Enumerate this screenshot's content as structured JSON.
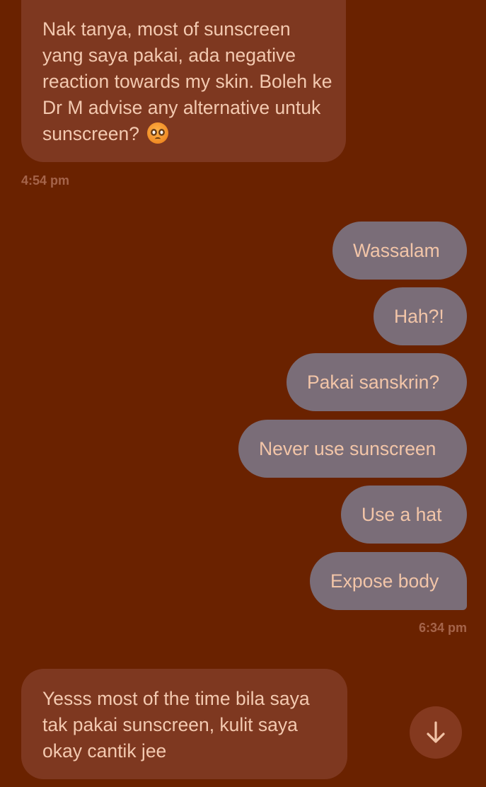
{
  "messages": {
    "incoming_1": {
      "text": "Nak tanya, most of sunscreen yang saya pakai, ada negative reaction towards my skin. Boleh ke Dr M advise any alternative untuk sunscreen?",
      "emoji": "pleading-face-emoji",
      "time": "4:54 pm"
    },
    "outgoing": [
      {
        "text": "Wassalam"
      },
      {
        "text": "Hah?!"
      },
      {
        "text": "Pakai sanskrin?"
      },
      {
        "text": "Never use sunscreen"
      },
      {
        "text": "Use a hat"
      },
      {
        "text": "Expose body"
      }
    ],
    "outgoing_time": "6:34 pm",
    "incoming_2": {
      "text": "Yesss most of the time bila saya tak pakai sunscreen, kulit saya okay cantik jee"
    }
  },
  "scroll_button": {
    "icon": "arrow-down-icon"
  },
  "colors": {
    "background": "#6a2200",
    "incoming_bubble": "#7e3820",
    "outgoing_bubble": "#7a6d78",
    "bubble_text": "#f3c9b0",
    "timestamp": "#a5644a"
  }
}
